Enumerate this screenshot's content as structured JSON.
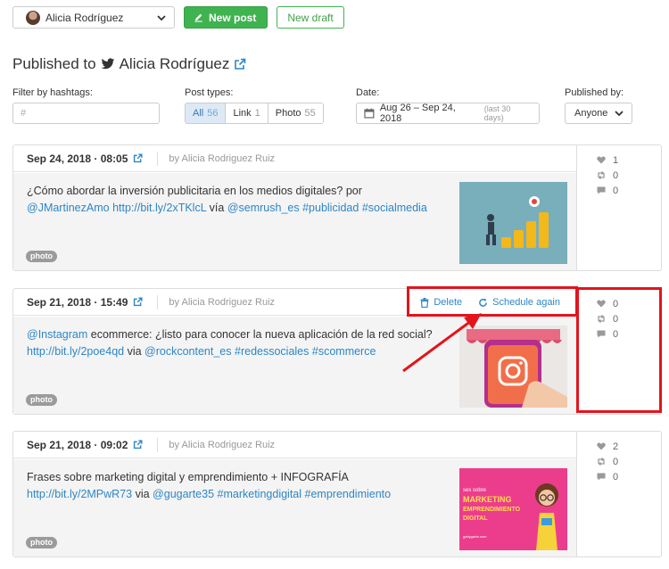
{
  "topbar": {
    "account": "Alicia Rodríguez",
    "new_post_label": "New post",
    "new_draft_label": "New draft"
  },
  "page": {
    "title_prefix": "Published to",
    "title_account": "Alicia Rodríguez"
  },
  "filters": {
    "hashtags_label": "Filter by hashtags:",
    "hashtags_placeholder": "#",
    "post_types_label": "Post types:",
    "post_types": [
      {
        "label": "All",
        "count": "56",
        "active": true
      },
      {
        "label": "Link",
        "count": "1",
        "active": false
      },
      {
        "label": "Photo",
        "count": "55",
        "active": false
      }
    ],
    "date_label": "Date:",
    "date_range": "Aug 26 – Sep 24, 2018",
    "date_note": "(last 30 days)",
    "published_by_label": "Published by:",
    "published_by_value": "Anyone"
  },
  "posts": [
    {
      "date": "Sep 24, 2018 · 08:05",
      "author": "by Alicia Rodriguez Ruiz",
      "text_parts": [
        {
          "t": "¿Cómo abordar la inversión publicitaria en los medios digitales? por "
        },
        {
          "t": "@JMartinezAmo",
          "link": true
        },
        {
          "t": " "
        },
        {
          "t": "http://bit.ly/2xTKlcL",
          "link": true
        },
        {
          "t": " vía "
        },
        {
          "t": "@semrush_es",
          "link": true
        },
        {
          "t": " "
        },
        {
          "t": "#publicidad",
          "link": true
        },
        {
          "t": " "
        },
        {
          "t": "#socialmedia",
          "link": true
        }
      ],
      "badge": "photo",
      "likes": "1",
      "retweets": "0",
      "replies": "0"
    },
    {
      "date": "Sep 21, 2018 · 15:49",
      "author": "by Alicia Rodriguez Ruiz",
      "text_parts": [
        {
          "t": "@Instagram",
          "link": true
        },
        {
          "t": " ecommerce: ¿listo para conocer la nueva aplicación de la red social? "
        },
        {
          "t": "http://bit.ly/2poe4qd",
          "link": true
        },
        {
          "t": " via "
        },
        {
          "t": "@rockcontent_es",
          "link": true
        },
        {
          "t": " "
        },
        {
          "t": "#redessociales",
          "link": true
        },
        {
          "t": " "
        },
        {
          "t": "#scommerce",
          "link": true
        }
      ],
      "badge": "photo",
      "likes": "0",
      "retweets": "0",
      "replies": "0",
      "delete_label": "Delete",
      "schedule_label": "Schedule again"
    },
    {
      "date": "Sep 21, 2018 · 09:02",
      "author": "by Alicia Rodriguez Ruiz",
      "text_parts": [
        {
          "t": "Frases sobre marketing digital y emprendimiento + INFOGRAFÍA "
        },
        {
          "t": "http://bit.ly/2MPwR73",
          "link": true
        },
        {
          "t": " via "
        },
        {
          "t": "@gugarte35",
          "link": true
        },
        {
          "t": " "
        },
        {
          "t": "#marketingdigital",
          "link": true
        },
        {
          "t": " "
        },
        {
          "t": "#emprendimiento",
          "link": true
        }
      ],
      "badge": "photo",
      "likes": "2",
      "retweets": "0",
      "replies": "0"
    }
  ],
  "thumb3": {
    "line1": "ses sobre",
    "line2": "MARKETING",
    "line3": "EMPRENDIMIENTO",
    "line4": "DIGITAL",
    "credit": "gabygarte.com"
  },
  "colors": {
    "accent_green": "#3fb34f",
    "link_blue": "#2d86c6",
    "annotation_red": "#e3141c"
  }
}
